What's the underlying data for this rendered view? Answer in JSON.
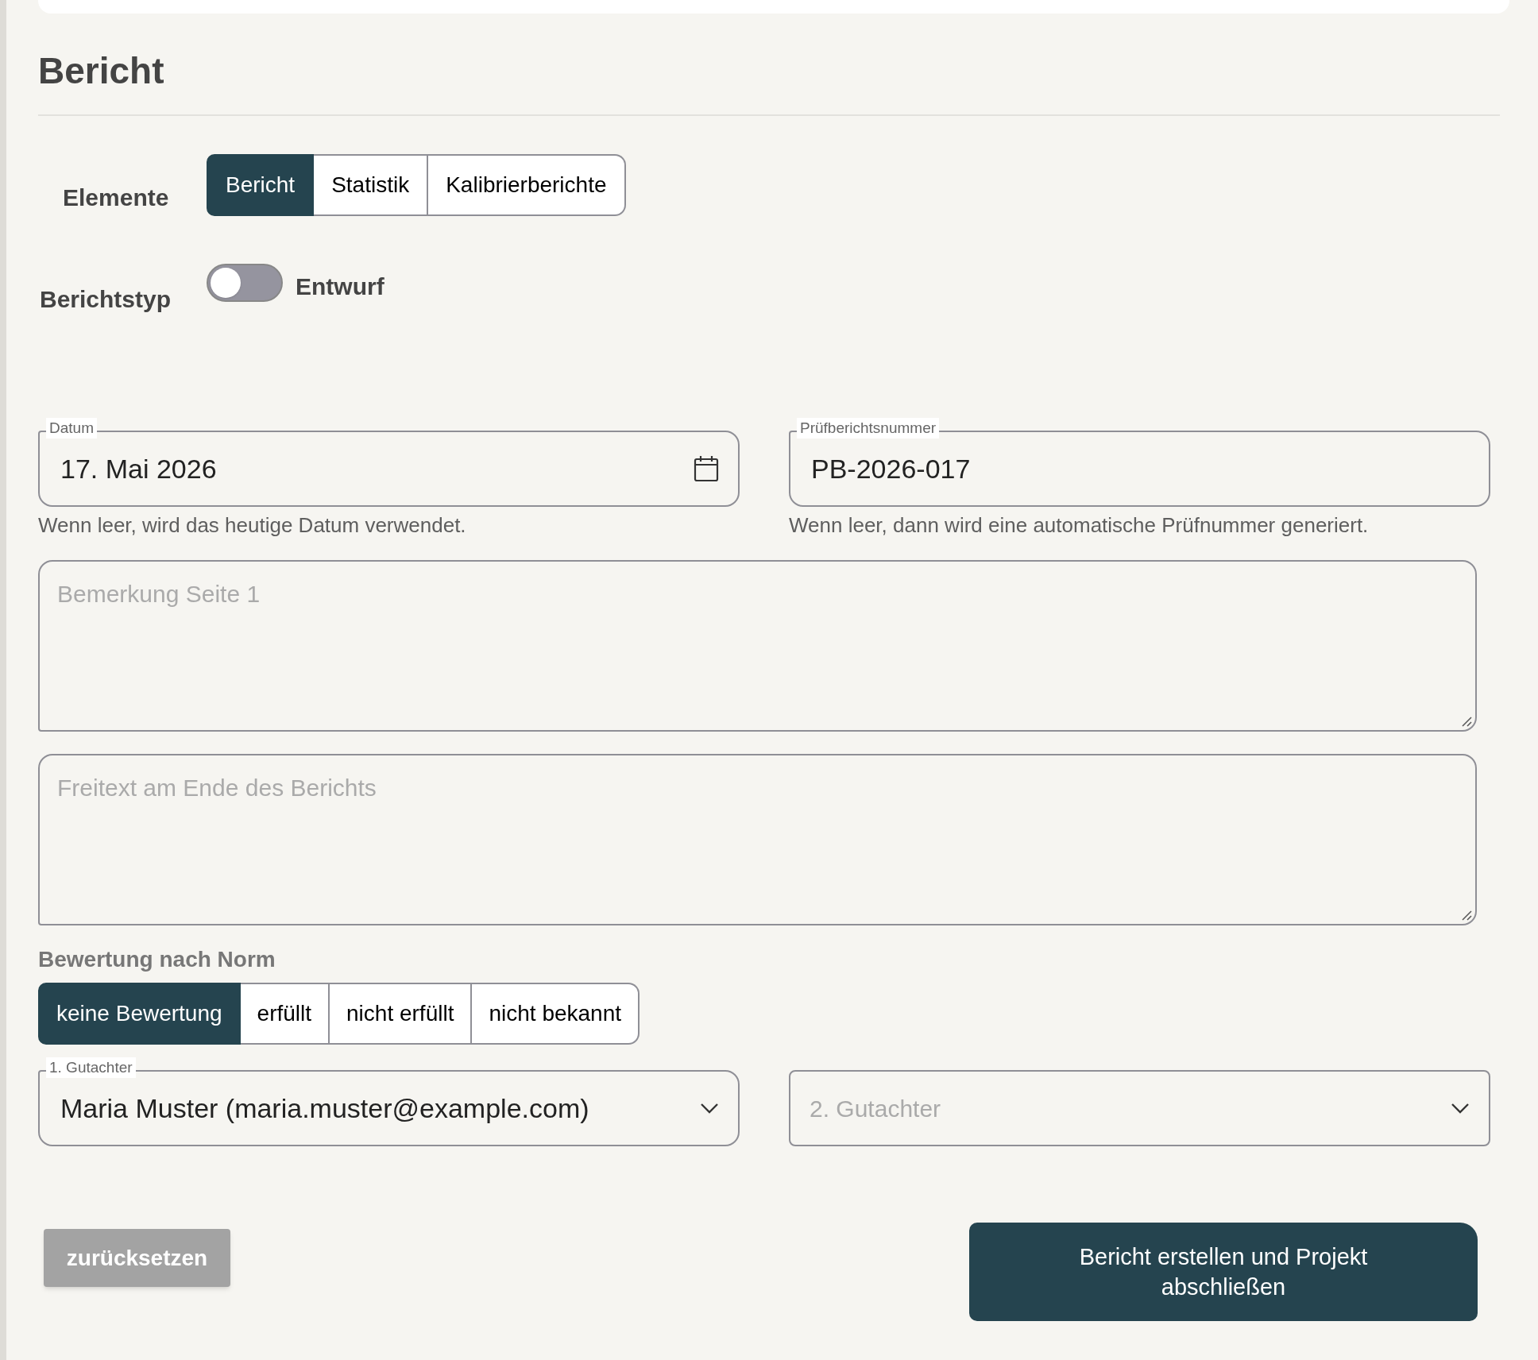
{
  "section_title": "Bericht",
  "elements": {
    "label": "Elemente",
    "options": [
      {
        "label": "Bericht",
        "selected": true
      },
      {
        "label": "Statistik",
        "selected": false
      },
      {
        "label": "Kalibrierberichte",
        "selected": false
      }
    ]
  },
  "report_type": {
    "label": "Berichtstyp",
    "on": false,
    "value_label": "Entwurf"
  },
  "date_field": {
    "label": "Datum",
    "value": "17. Mai 2026",
    "helper": "Wenn leer, wird das heutige Datum verwendet."
  },
  "number_field": {
    "label": "Prüfberichtsnummer",
    "value": "PB-2026-017",
    "helper": "Wenn leer, dann wird eine automatische Prüfnummer generiert."
  },
  "remark_field": {
    "placeholder": "Bemerkung Seite 1"
  },
  "freetext_field": {
    "placeholder": "Freitext am Ende des Berichts"
  },
  "rating": {
    "label": "Bewertung nach Norm",
    "options": [
      {
        "label": "keine Bewertung",
        "selected": true
      },
      {
        "label": "erfüllt",
        "selected": false
      },
      {
        "label": "nicht erfüllt",
        "selected": false
      },
      {
        "label": "nicht bekannt",
        "selected": false
      }
    ]
  },
  "reviewer_1": {
    "label": "1. Gutachter",
    "value": "Maria Muster (maria.muster@example.com)"
  },
  "reviewer_2": {
    "placeholder": "2. Gutachter"
  },
  "buttons": {
    "reset": "zurücksetzen",
    "submit": "Bericht erstellen und Projekt abschließen"
  }
}
